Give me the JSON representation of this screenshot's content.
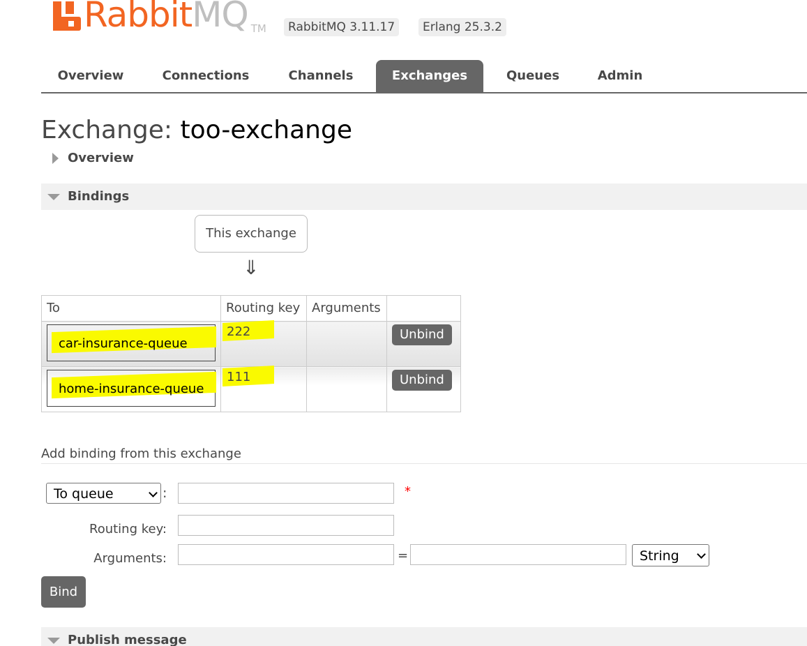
{
  "header": {
    "logo_rabbit": "Rabbit",
    "logo_mq": "MQ",
    "logo_tm": "TM",
    "rabbitmq_version": "RabbitMQ 3.11.17",
    "erlang_version": "Erlang 25.3.2",
    "brand_color": "#f26522"
  },
  "tabs": [
    {
      "label": "Overview"
    },
    {
      "label": "Connections"
    },
    {
      "label": "Channels"
    },
    {
      "label": "Exchanges",
      "active": true
    },
    {
      "label": "Queues"
    },
    {
      "label": "Admin"
    }
  ],
  "page": {
    "title_prefix": "Exchange:",
    "exchange_name": "too-exchange"
  },
  "sections": {
    "overview": "Overview",
    "bindings": "Bindings",
    "publish": "Publish message"
  },
  "bindings": {
    "source_label": "This exchange",
    "arrow": "⇓",
    "columns": [
      "To",
      "Routing key",
      "Arguments",
      ""
    ],
    "rows": [
      {
        "to": "car-insurance-queue",
        "routing_key": "222",
        "arguments": "",
        "action": "Unbind"
      },
      {
        "to": "home-insurance-queue",
        "routing_key": "111",
        "arguments": "",
        "action": "Unbind"
      }
    ],
    "highlight_color": "#fafa00"
  },
  "add_binding": {
    "heading": "Add binding from this exchange",
    "destination_type": "To queue",
    "destination_value": "",
    "required_mark": "*",
    "routing_key_label": "Routing key:",
    "routing_key_value": "",
    "arguments_label": "Arguments:",
    "argument_key": "",
    "argument_value": "",
    "argument_type": "String",
    "bind_label": "Bind"
  }
}
